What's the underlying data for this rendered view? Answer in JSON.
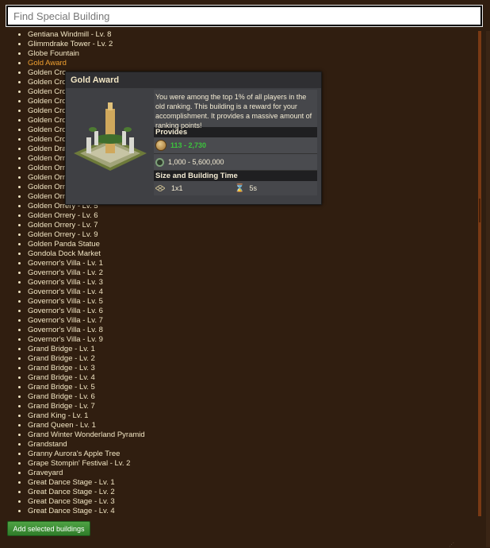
{
  "search": {
    "placeholder": "Find Special Building",
    "value": ""
  },
  "buildings": [
    "Gentiana Windmill - Lv. 8",
    "Glimmdrake Tower - Lv. 2",
    "Globe Fountain",
    "Gold Award",
    "Golden Cro",
    "Golden Cro",
    "Golden Cro",
    "Golden Cro",
    "Golden Cro",
    "Golden Cro",
    "Golden Cro",
    "Golden Cro",
    "Golden Dra",
    "Golden Orr",
    "Golden Orr",
    "Golden Orr",
    "Golden Orr",
    "Golden Orr",
    "Golden Orrery - Lv. 5",
    "Golden Orrery - Lv. 6",
    "Golden Orrery - Lv. 7",
    "Golden Orrery - Lv. 9",
    "Golden Panda Statue",
    "Gondola Dock Market",
    "Governor's Villa - Lv. 1",
    "Governor's Villa - Lv. 2",
    "Governor's Villa - Lv. 3",
    "Governor's Villa - Lv. 4",
    "Governor's Villa - Lv. 5",
    "Governor's Villa - Lv. 6",
    "Governor's Villa - Lv. 7",
    "Governor's Villa - Lv. 8",
    "Governor's Villa - Lv. 9",
    "Grand Bridge - Lv. 1",
    "Grand Bridge - Lv. 2",
    "Grand Bridge - Lv. 3",
    "Grand Bridge - Lv. 4",
    "Grand Bridge - Lv. 5",
    "Grand Bridge - Lv. 6",
    "Grand Bridge - Lv. 7",
    "Grand King - Lv. 1",
    "Grand Queen - Lv. 1",
    "Grand Winter Wonderland Pyramid",
    "Grandstand",
    "Granny Aurora's Apple Tree",
    "Grape Stompin' Festival - Lv. 2",
    "Graveyard",
    "Great Dance Stage - Lv. 1",
    "Great Dance Stage - Lv. 2",
    "Great Dance Stage - Lv. 3",
    "Great Dance Stage - Lv. 4"
  ],
  "highlighted_index": 3,
  "tooltip": {
    "title": "Gold Award",
    "description": "You were among the top 1% of all players in the old ranking. This building is a reward for your accomplishment. It provides a massive amount of ranking points!",
    "provides_heading": "Provides",
    "coins_min": "113",
    "coins_sep": " - ",
    "coins_max": "2,730",
    "ranking_points": "1,000 - 5,600,000",
    "size_heading": "Size and Building Time",
    "size": "1x1",
    "build_time": "5s",
    "icons": {
      "coins": "coin-icon",
      "ranking": "ranking-points-icon",
      "size": "size-grid-icon",
      "time": "hourglass-icon"
    }
  },
  "add_button_label": "Add selected buildings",
  "colors": {
    "background": "#301e10",
    "list_text": "#f2e6c4",
    "highlight": "#f0a030",
    "button": "#3c8f35",
    "coins_text": "#3cc43c"
  }
}
